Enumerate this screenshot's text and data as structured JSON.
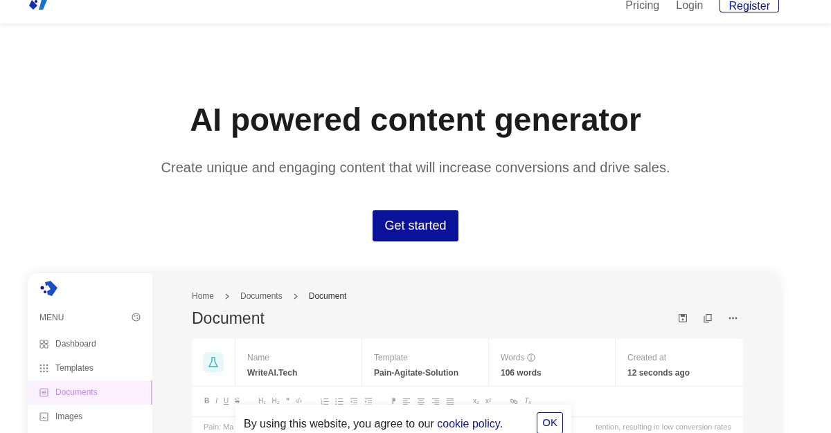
{
  "navbar": {
    "links": [
      "Pricing",
      "Login"
    ],
    "register": "Register"
  },
  "hero": {
    "title": "AI powered content generator",
    "subtitle": "Create unique and engaging content that will increase conversions and drive sales.",
    "cta": "Get started"
  },
  "app": {
    "sidebar": {
      "menu_label": "MENU",
      "items": [
        {
          "label": "Dashboard",
          "selected": false
        },
        {
          "label": "Templates",
          "selected": false
        },
        {
          "label": "Documents",
          "selected": true
        },
        {
          "label": "Images",
          "selected": false
        }
      ]
    },
    "breadcrumb": [
      "Home",
      "Documents",
      "Document"
    ],
    "page_title": "Document",
    "info": [
      {
        "label": "Name",
        "value": "WriteAI.Tech",
        "info_icon": false
      },
      {
        "label": "Template",
        "value": "Pain-Agitate-Solution",
        "info_icon": false
      },
      {
        "label": "Words",
        "value": "106 words",
        "info_icon": true
      },
      {
        "label": "Created at",
        "value": "12 seconds ago",
        "info_icon": false
      }
    ],
    "toolbar": [
      [
        {
          "kind": "bold",
          "text": "B"
        },
        {
          "kind": "italic",
          "text": "I"
        },
        {
          "kind": "underline",
          "text": "U"
        },
        {
          "kind": "strike",
          "text": "S"
        }
      ],
      [
        {
          "kind": "text",
          "text": "H₁"
        },
        {
          "kind": "text",
          "text": "H₂"
        },
        {
          "kind": "text",
          "text": "❞"
        },
        {
          "kind": "text",
          "text": "‹/›"
        }
      ],
      [
        {
          "kind": "olist"
        },
        {
          "kind": "ulist"
        },
        {
          "kind": "outdent"
        },
        {
          "kind": "indent"
        }
      ],
      [
        {
          "kind": "text",
          "text": "⁋"
        },
        {
          "kind": "alignleft"
        },
        {
          "kind": "aligncenter"
        },
        {
          "kind": "alignright"
        },
        {
          "kind": "justify"
        }
      ],
      [
        {
          "kind": "text",
          "text": "x₂"
        },
        {
          "kind": "text",
          "text": "x²"
        }
      ],
      [
        {
          "kind": "link"
        },
        {
          "kind": "italic",
          "text": "Tₓ"
        }
      ]
    ],
    "editor": {
      "left": "Pain: Ma",
      "right": "tention, resulting in low conversion rates"
    }
  },
  "cookie": {
    "text": "By using this website, you agree to our ",
    "link": "cookie policy",
    "after": ".",
    "button": "OK"
  }
}
